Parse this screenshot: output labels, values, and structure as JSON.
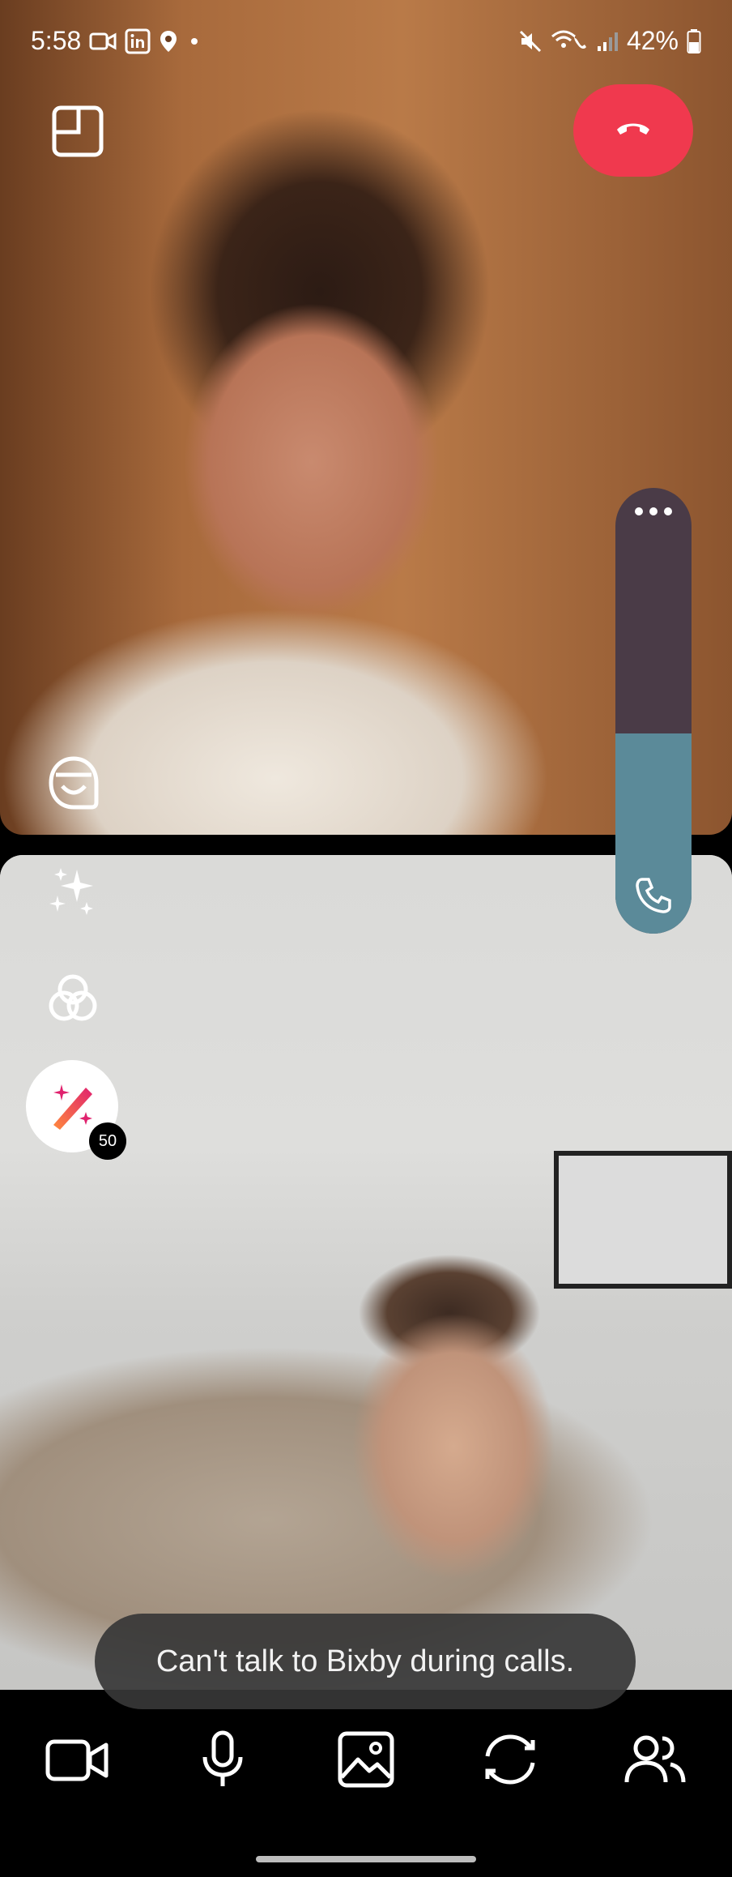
{
  "status_bar": {
    "time": "5:58",
    "battery": "42%",
    "left_icons": [
      "video-call-icon",
      "linkedin-icon",
      "location-icon",
      "dot-icon"
    ],
    "right_icons": [
      "mute-icon",
      "wifi-calling-icon",
      "signal-icon",
      "battery-icon"
    ]
  },
  "call": {
    "volume_level": 0.45,
    "end_call_color": "#f0394e"
  },
  "effects": {
    "badge_count": "50"
  },
  "toast": {
    "message": "Can't talk to Bixby during calls."
  },
  "bottom_nav": {
    "icons": [
      "video-camera-icon",
      "microphone-icon",
      "image-icon",
      "switch-camera-icon",
      "people-icon"
    ]
  }
}
